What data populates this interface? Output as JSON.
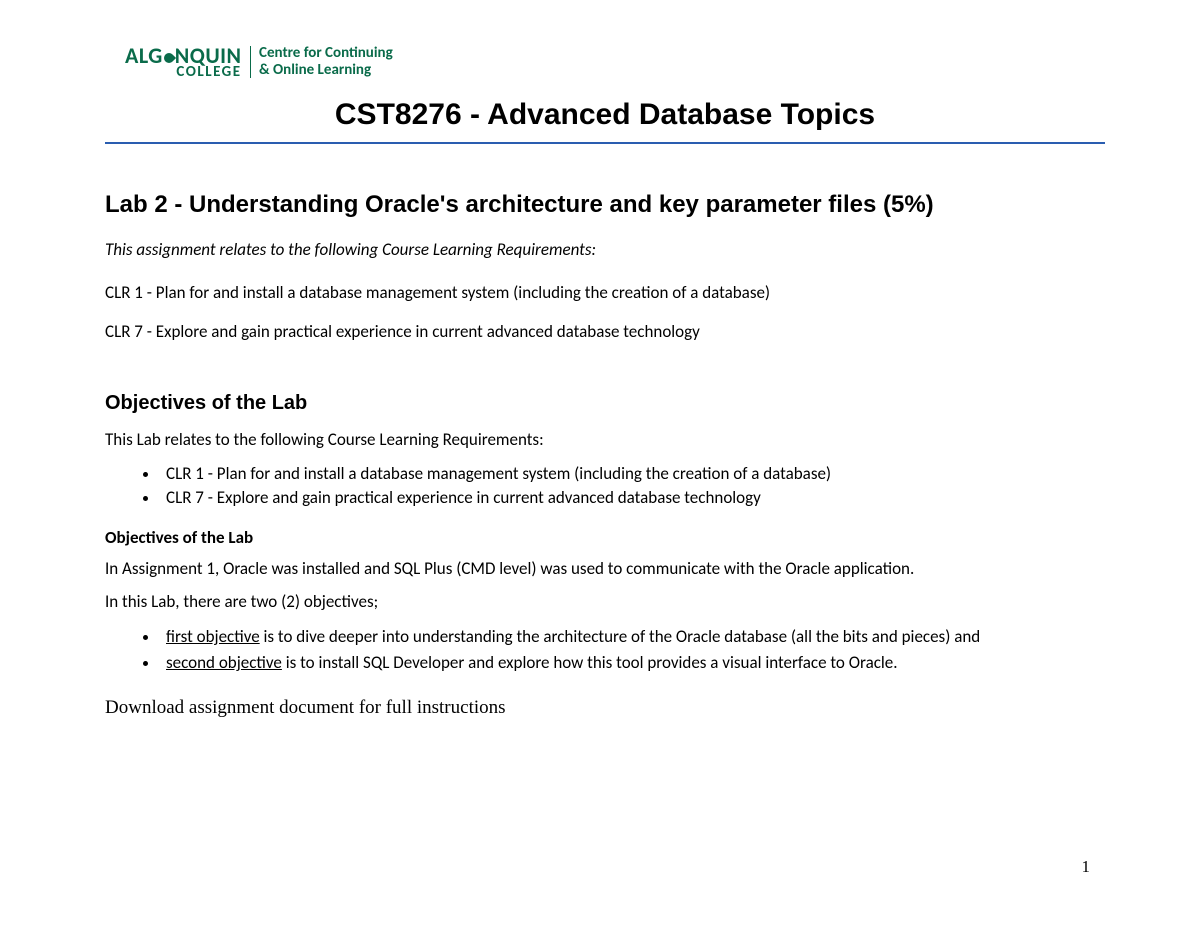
{
  "logo": {
    "main": "ALGONQUIN",
    "sub": "COLLEGE",
    "tagline_line1": "Centre for Continuing",
    "tagline_line2": "& Online Learning"
  },
  "course_title": "CST8276 - Advanced Database Topics",
  "lab_title": "Lab 2 - Understanding Oracle's architecture and key parameter files (5%)",
  "clr_intro": "This assignment relates to the following Course Learning Requirements:",
  "clr_items": [
    "CLR 1 - Plan for and install a database management system (including the creation of a database)",
    "CLR 7 - Explore and gain practical experience in current advanced database technology"
  ],
  "objectives_heading": "Objectives of the Lab",
  "objectives_intro": "This Lab relates to the following Course Learning Requirements:",
  "objectives_clr_list": [
    "CLR 1 - Plan for and install a database management system (including the creation of a database)",
    "CLR 7 - Explore and gain practical experience in current advanced database technology"
  ],
  "objectives_subheading": "Objectives of the Lab",
  "objectives_para1": "In Assignment 1, Oracle was installed and SQL Plus (CMD level) was used to communicate with the Oracle application.",
  "objectives_para2": "In this Lab, there are two (2) objectives;",
  "objectives_list": [
    {
      "underlined": "first objective",
      "rest": " is to dive deeper into understanding the architecture of the Oracle database (all the bits and pieces) and"
    },
    {
      "underlined": "second objective",
      "rest": " is to install SQL Developer and explore how this tool provides a visual interface to Oracle."
    }
  ],
  "download_text": "Download assignment document for full instructions",
  "page_number": "1"
}
